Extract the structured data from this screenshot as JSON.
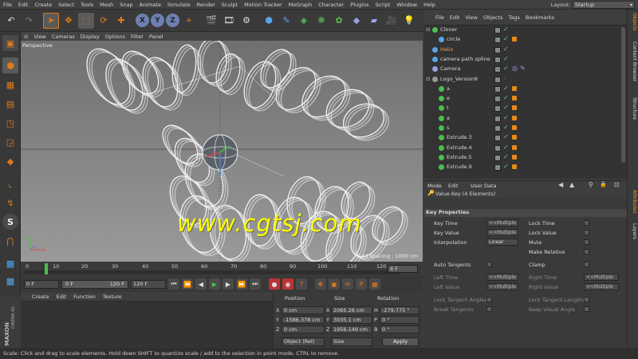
{
  "menubar": {
    "items": [
      "File",
      "Edit",
      "Create",
      "Select",
      "Tools",
      "Mesh",
      "Snap",
      "Animate",
      "Simulate",
      "Render",
      "Sculpt",
      "Motion Tracker",
      "MoGraph",
      "Character",
      "Plugins",
      "Script",
      "Window",
      "Help"
    ],
    "layout_label": "Layout:",
    "layout_value": "Startup"
  },
  "toolbar": {
    "axis_x": "X",
    "axis_y": "Y",
    "axis_z": "Z"
  },
  "viewport": {
    "menu": [
      "View",
      "Cameras",
      "Display",
      "Options",
      "Filter",
      "Panel"
    ],
    "label": "Perspective",
    "grid_spacing": "Grid Spacing : 1000 cm",
    "watermark": "www.cgtsj.com"
  },
  "timeline": {
    "ticks": [
      "0",
      "10",
      "20",
      "30",
      "40",
      "50",
      "60",
      "70",
      "80",
      "90",
      "100",
      "110",
      "120"
    ],
    "current_frame": "6 F"
  },
  "playback": {
    "start": "0 F",
    "min": "0 F",
    "max": "120 F",
    "end": "120 F"
  },
  "material_manager": {
    "menu": [
      "Create",
      "Edit",
      "Function",
      "Texture"
    ],
    "brand_top": "MAXON",
    "brand_bottom": "CINEMA 4D"
  },
  "coordinates": {
    "headers": [
      "Position",
      "Size",
      "Rotation"
    ],
    "rows": [
      {
        "axis": "X",
        "pos": "0 cm",
        "size_axis": "X",
        "size": "2065.26 cm",
        "rot_axis": "H",
        "rot": "-279.775 °"
      },
      {
        "axis": "Y",
        "pos": "-1586.378 cm",
        "size_axis": "Y",
        "size": "3035.1 cm",
        "rot_axis": "P",
        "rot": "0 °"
      },
      {
        "axis": "Z",
        "pos": "0 cm",
        "size_axis": "Z",
        "size": "1956.149 cm",
        "rot_axis": "B",
        "rot": "0 °"
      }
    ],
    "mode": "Object (Rel)",
    "size_mode": "Size",
    "apply": "Apply"
  },
  "object_manager": {
    "menu": [
      "File",
      "Edit",
      "View",
      "Objects",
      "Tags",
      "Bookmarks"
    ],
    "objects": [
      {
        "name": "Cloner",
        "indent": 0,
        "orange_tag": false
      },
      {
        "name": "circle",
        "indent": 1,
        "orange_tag": true
      },
      {
        "name": "Helix",
        "indent": 0,
        "orange_tag": false
      },
      {
        "name": "camera path spline",
        "indent": 0,
        "orange_tag": false
      },
      {
        "name": "Camera",
        "indent": 0,
        "orange_tag": false
      },
      {
        "name": "Logo_Version8",
        "indent": 0,
        "orange_tag": false
      },
      {
        "name": "a",
        "indent": 1,
        "orange_tag": true
      },
      {
        "name": "e",
        "indent": 1,
        "orange_tag": true
      },
      {
        "name": "t",
        "indent": 1,
        "orange_tag": true
      },
      {
        "name": "a",
        "indent": 1,
        "orange_tag": true
      },
      {
        "name": "s",
        "indent": 1,
        "orange_tag": true
      },
      {
        "name": "Extrude.3",
        "indent": 1,
        "orange_tag": true
      },
      {
        "name": "Extrude.4",
        "indent": 1,
        "orange_tag": true
      },
      {
        "name": "Extrude.5",
        "indent": 1,
        "orange_tag": true
      },
      {
        "name": "Extrude.9",
        "indent": 1,
        "orange_tag": true
      }
    ]
  },
  "right_tabs": [
    "Objects",
    "Content Browser",
    "Structure",
    "Attributes",
    "Layers"
  ],
  "attributes": {
    "mode_label": "Mode",
    "edit_label": "Edit",
    "user_data_label": "User Data",
    "title": "Value Key (4 Elements)",
    "section": "Key Properties",
    "key_time_label": "Key Time",
    "key_time_value": "<<Multiple",
    "key_value_label": "Key Value",
    "key_value_value": "<<Multiple",
    "interp_label": "Interpolation",
    "interp_value": "Linear",
    "lock_time": "Lock Time",
    "lock_value": "Lock Value",
    "mute": "Mute",
    "make_relative": "Make Relative",
    "auto_tangents": "Auto Tangents",
    "clamp": "Clamp",
    "left_time": "Left Time",
    "left_value": "Left Value",
    "right_time": "Right Time",
    "right_value": "Right Value",
    "multiple": "<<Multiple",
    "lock_tangent_angles": "Lock Tangent Angles",
    "lock_tangent_lengths": "Lock Tangent Lengths",
    "break_tangents": "Break Tangents",
    "keep_visual_angle": "Keep Visual Angle"
  },
  "status": "Scale: Click and drag to scale elements. Hold down SHIFT to quantize scale / add to the selection in point mode, CTRL to remove."
}
